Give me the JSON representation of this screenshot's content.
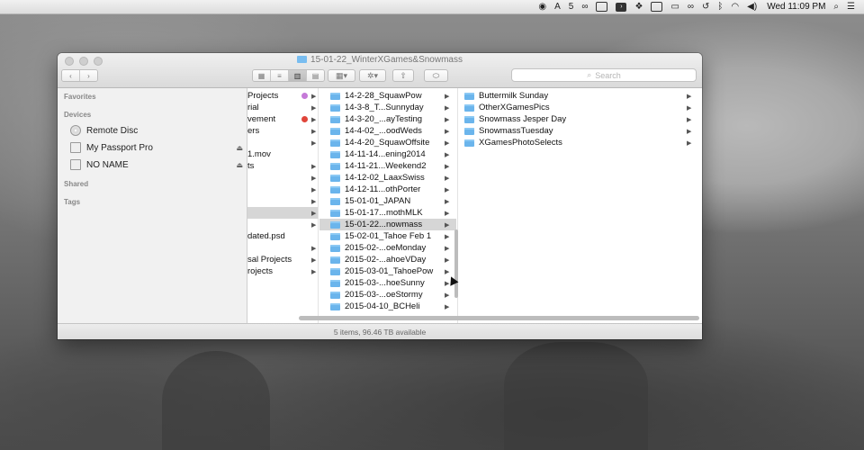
{
  "menubar": {
    "badge_count": "5",
    "clock": "Wed 11:09 PM"
  },
  "window": {
    "title": "15-01-22_WinterXGames&Snowmass",
    "search_placeholder": "Search",
    "status": "5 items, 96.46 TB available"
  },
  "sidebar": {
    "favorites_label": "Favorites",
    "devices_label": "Devices",
    "shared_label": "Shared",
    "tags_label": "Tags",
    "devices": [
      {
        "label": "Remote Disc"
      },
      {
        "label": "My Passport Pro"
      },
      {
        "label": "NO NAME"
      }
    ]
  },
  "column1": {
    "items": [
      {
        "label": "Projects"
      },
      {
        "label": "rial"
      },
      {
        "label": "vement"
      },
      {
        "label": "ers"
      },
      {
        "label": "1.mov"
      },
      {
        "label": "ts"
      },
      {
        "label": "dated.psd"
      },
      {
        "label": "sal Projects"
      },
      {
        "label": "rojects"
      }
    ]
  },
  "column2": {
    "items": [
      {
        "label": "14-2-28_SquawPow"
      },
      {
        "label": "14-3-8_T...Sunnyday"
      },
      {
        "label": "14-3-20_...ayTesting"
      },
      {
        "label": "14-4-02_...oodWeds"
      },
      {
        "label": "14-4-20_SquawOffsite"
      },
      {
        "label": "14-11-14...ening2014"
      },
      {
        "label": "14-11-21...Weekend2"
      },
      {
        "label": "14-12-02_LaaxSwiss"
      },
      {
        "label": "14-12-11...othPorter"
      },
      {
        "label": "15-01-01_JAPAN"
      },
      {
        "label": "15-01-17...mothMLK"
      },
      {
        "label": "15-01-22...nowmass"
      },
      {
        "label": "15-02-01_Tahoe Feb 1"
      },
      {
        "label": "2015-02-...oeMonday"
      },
      {
        "label": "2015-02-...ahoeVDay"
      },
      {
        "label": "2015-03-01_TahoePow"
      },
      {
        "label": "2015-03-...hoeSunny"
      },
      {
        "label": "2015-03-...oeStormy"
      },
      {
        "label": "2015-04-10_BCHeli"
      }
    ]
  },
  "column3": {
    "items": [
      {
        "label": "Buttermilk Sunday"
      },
      {
        "label": "OtherXGamesPics"
      },
      {
        "label": "Snowmass Jesper Day"
      },
      {
        "label": "SnowmassTuesday"
      },
      {
        "label": "XGamesPhotoSelects"
      }
    ]
  },
  "colors": {
    "folder": "#6bb5ec",
    "tag_purple": "#c57ad8",
    "tag_red": "#e0453a",
    "selection": "#d6d6d6"
  }
}
